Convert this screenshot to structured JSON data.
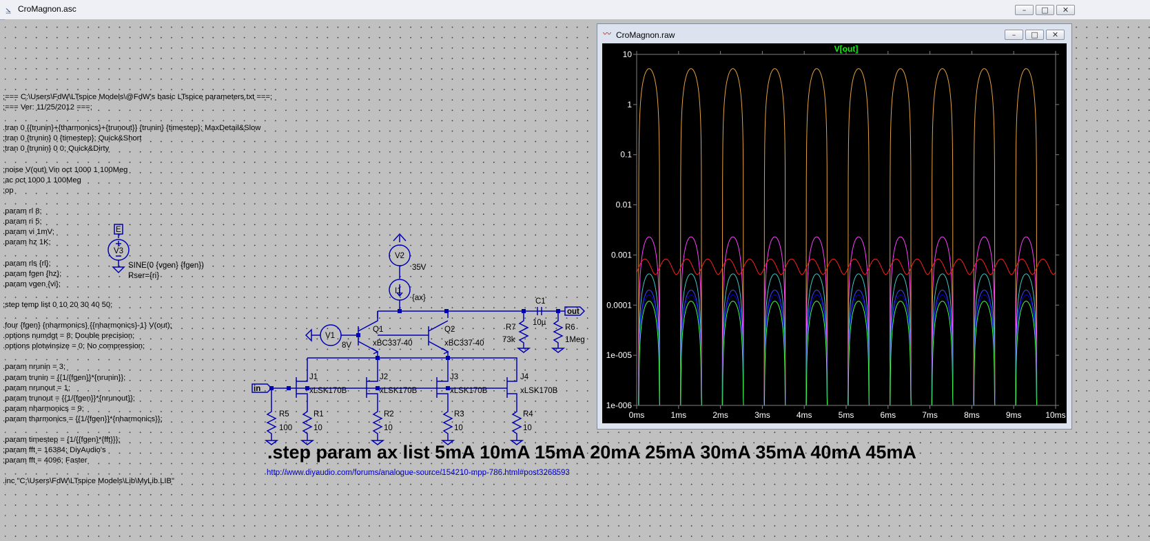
{
  "window": {
    "title": "CroMagnon.asc",
    "app_icon": "ltspice-schematic-icon",
    "controls": {
      "minimize": "–",
      "maximize": "□",
      "close": "✕"
    }
  },
  "netlist_lines": [
    ";=== C:\\Users\\FdW\\LTspice Models\\@FdW's basic LTspice parameters.txt ===;",
    ";=== Ver: 11/25/2012 ===;",
    "",
    ".tran 0 {{trunin}+{tharmonics}+{trunout}} {trunin} {timestep}; MaxDetail&Slow",
    ";tran 0 {trunin} 0 {timestep}; Quick&Short",
    ";tran 0 {trunin} 0 0; Quick&Dirty",
    "",
    ";noise V(out) Vin oct 1000 1 100Meg",
    ";ac oct 1000 1 100Meg",
    ";op",
    "",
    ".param rl 8;",
    ".param ri 5;",
    ".param vi 1mV;",
    ".param hz 1K;",
    "",
    ".param rls {rl};",
    ".param fgen {hz};",
    ".param vgen {vi};",
    "",
    ";step temp list 0 10 20 30 40 50;",
    "",
    ".four {fgen} {nharmonics} {{nharmonics}-1} V(out);",
    ".options numdgt = 8; Double precision;",
    ".options plotwinsize = 0; No compression;",
    "",
    ".param nrunin = 3;",
    ".param trunin = {{1/{fgen}}*{nrunin}};",
    ".param nrunout = 1;",
    ".param trunout = {{1/{fgen}}*{nrunout}};",
    ".param nharmonics = 9;",
    ".param tharmonics = {{1/{fgen}}*{nharmonics}};",
    "",
    ".param timestep = {1/{{fgen}*{fft}}};",
    ";param fft = 16384; DiyAudio's",
    ";param fft = 4096; Faster",
    "",
    ".inc \"C:\\Users\\FdW\\LTspice Models\\Lib\\MyLib.LIB\""
  ],
  "schematic": {
    "v3": {
      "name": "V3",
      "value": "SINE(0 {vgen} {fgen})",
      "rser": "Rser={ri}"
    },
    "v2": {
      "name": "V2",
      "value": "35V"
    },
    "i1": {
      "name": "I1",
      "value": "{ax}"
    },
    "v1": {
      "name": "V1",
      "value": "8V"
    },
    "q1": {
      "name": "Q1",
      "model": "xBC337-40"
    },
    "q2": {
      "name": "Q2",
      "model": "xBC337-40"
    },
    "c1": {
      "name": "C1",
      "value": "10µ"
    },
    "r7": {
      "name": "R7",
      "value": "73k"
    },
    "r6": {
      "name": "R6",
      "value": "1Meg"
    },
    "j1": {
      "name": "J1",
      "model": "xLSK170B"
    },
    "j2": {
      "name": "J2",
      "model": "xLSK170B"
    },
    "j3": {
      "name": "J3",
      "model": "xLSK170B"
    },
    "j4": {
      "name": "J4",
      "model": "xLSK170B"
    },
    "r5": {
      "name": "R5",
      "value": "100"
    },
    "r1": {
      "name": "R1",
      "value": "10"
    },
    "r2": {
      "name": "R2",
      "value": "10"
    },
    "r3": {
      "name": "R3",
      "value": "10"
    },
    "r4": {
      "name": "R4",
      "value": "10"
    },
    "port_in": "in",
    "port_out": "out"
  },
  "step_directive": ".step param ax list 5mA 10mA 15mA 20mA 25mA 30mA 35mA 40mA 45mA",
  "link": "http://www.diyaudio.com/forums/analogue-source/154210-mpp-786.html#post3268593",
  "plot_window": {
    "title": "CroMagnon.raw",
    "icon": "waveform-icon",
    "trace_label": "V[out]",
    "background": "#000000",
    "frame_color": "#808080",
    "trace_label_color": "#00ff00"
  },
  "chart_data": {
    "type": "line",
    "title": "V[out]",
    "xlabel": "",
    "ylabel": "",
    "x_unit": "ms",
    "x_ticks": [
      "0ms",
      "1ms",
      "2ms",
      "3ms",
      "4ms",
      "5ms",
      "6ms",
      "7ms",
      "8ms",
      "9ms",
      "10ms"
    ],
    "y_ticks": [
      "10",
      "1",
      "0.1",
      "0.01",
      "0.001",
      "0.0001",
      "1e-005",
      "1e-006"
    ],
    "xlim": [
      0,
      10
    ],
    "ylim": [
      1e-06,
      10
    ],
    "yscale": "log",
    "grid": false,
    "period_ms": 1,
    "series": [
      {
        "color": "#e6a23c",
        "peak": 5.2,
        "floor": 1e-06
      },
      {
        "color": "#ff40ff",
        "peak": 0.0023,
        "floor": 1e-06
      },
      {
        "color": "#40c8c8",
        "peak": 0.00042,
        "floor": 1e-06
      },
      {
        "color": "#4040ff",
        "peak": 0.0002,
        "floor": 1e-06
      },
      {
        "color": "#0000c0",
        "peak": 0.00016,
        "floor": 1e-06
      },
      {
        "color": "#40ff40",
        "peak": 0.00012,
        "floor": 1e-06
      },
      {
        "color": "#ff2020",
        "mean": 0.00062,
        "ripple": 0.34
      }
    ]
  }
}
